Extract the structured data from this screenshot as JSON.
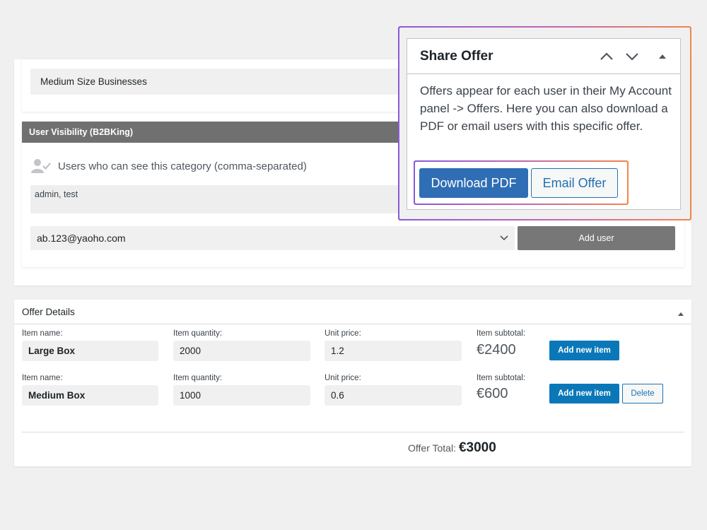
{
  "group": {
    "selected_value": "Medium Size Businesses"
  },
  "visibility": {
    "header": "User Visibility (B2BKing)",
    "users_label": "Users who can see this category (comma-separated)",
    "users_value": "admin, test",
    "user_select_value": "ab.123@yaoho.com",
    "add_user_label": "Add user",
    "icon": "user-check-icon"
  },
  "offer": {
    "title": "Offer Details",
    "labels": {
      "item_name": "Item name:",
      "item_quantity": "Item quantity:",
      "unit_price": "Unit price:",
      "item_subtotal": "Item subtotal:"
    },
    "items": [
      {
        "name": "Large Box",
        "quantity": "2000",
        "unit_price": "1.2",
        "subtotal": "€2400",
        "add_label": "Add new item"
      },
      {
        "name": "Medium Box",
        "quantity": "1000",
        "unit_price": "0.6",
        "subtotal": "€600",
        "add_label": "Add new item",
        "delete_label": "Delete"
      }
    ],
    "total_label": "Offer Total:",
    "total_value": "€3000"
  },
  "share": {
    "title": "Share Offer",
    "description": "Offers appear for each user in their My Account panel -> Offers. Here you can also download a PDF or email users with this specific offer.",
    "download_label": "Download PDF",
    "email_label": "Email Offer",
    "icons": [
      "chevron-up-icon",
      "chevron-down-icon",
      "caret-up-icon"
    ]
  },
  "colors": {
    "primary": "#2f6eb5",
    "wp_blue": "#0a78b8",
    "header_gray": "#707070",
    "highlight_start": "#8a5ad8",
    "highlight_end": "#f0874a"
  }
}
